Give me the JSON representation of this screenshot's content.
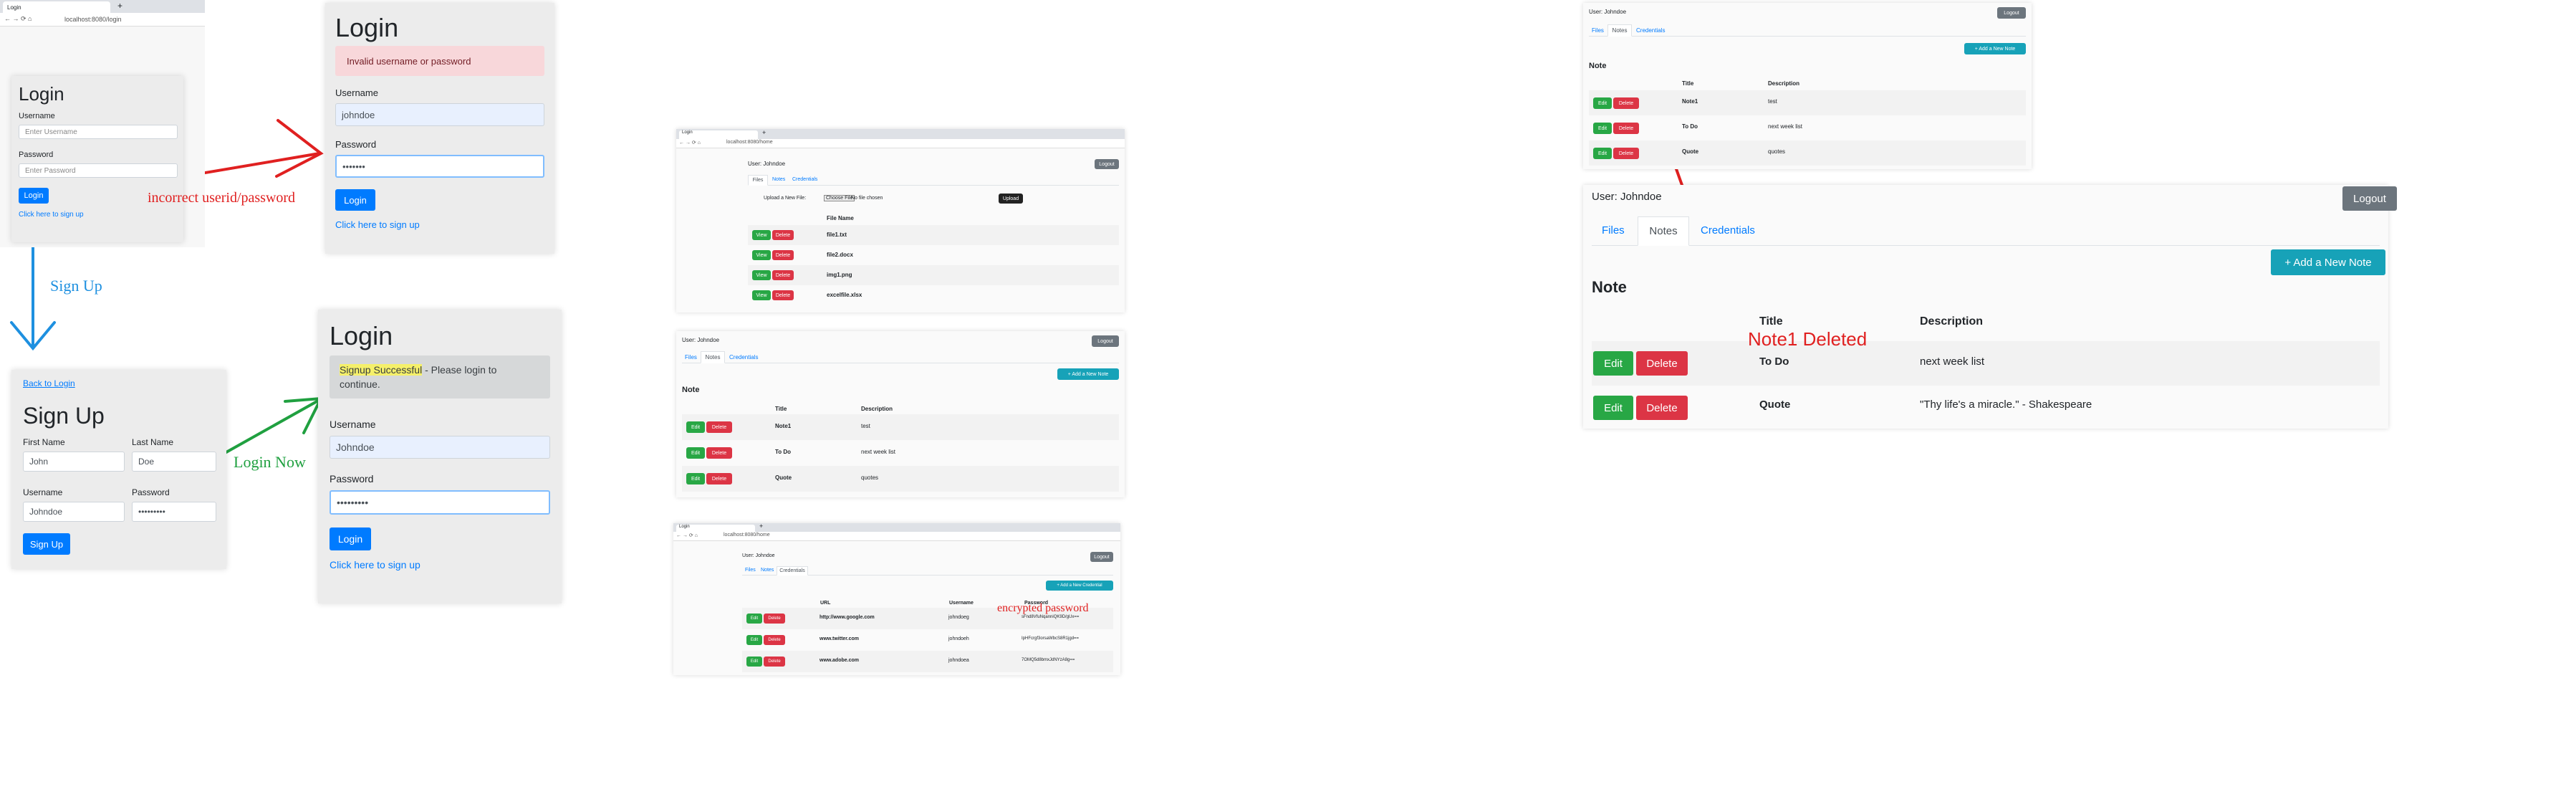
{
  "browser": {
    "tab_title": "Login",
    "new_tab": "+",
    "url": "localhost:8080/login",
    "url2": "localhost:8080/home"
  },
  "login1": {
    "title": "Login",
    "username_label": "Username",
    "username_placeholder": "Enter Username",
    "password_label": "Password",
    "password_placeholder": "Enter Password",
    "button": "Login",
    "signup_link": "Click here to sign up"
  },
  "login_error": {
    "title": "Login",
    "alert": "Invalid username or password",
    "username_label": "Username",
    "username_value": "johndoe",
    "password_label": "Password",
    "password_value": "•••••••",
    "button": "Login",
    "signup_link": "Click here to sign up"
  },
  "signup": {
    "back_link": "Back to Login",
    "title": "Sign Up",
    "first_name_label": "First Name",
    "first_name_value": "John",
    "last_name_label": "Last Name",
    "last_name_value": "Doe",
    "username_label": "Username",
    "username_value": "Johndoe",
    "password_label": "Password",
    "password_value": "•••••••••",
    "button": "Sign Up"
  },
  "login_success": {
    "title": "Login",
    "alert_highlight": "Signup Successful",
    "alert_rest": " - Please login to continue.",
    "username_label": "Username",
    "username_value": "Johndoe",
    "password_label": "Password",
    "password_value": "•••••••••",
    "button": "Login",
    "signup_link": "Click here to sign up"
  },
  "annotations": {
    "incorrect": "incorrect userid/password",
    "signup": "Sign Up",
    "login_now": "Login Now",
    "encrypted": "encrypted password",
    "deleted": "Note1 Deleted"
  },
  "home": {
    "user": "User: Johndoe",
    "logout": "Logout",
    "tabs": [
      "Files",
      "Notes",
      "Credentials"
    ],
    "upload_label": "Upload a New File:",
    "choose_file": "Choose File",
    "no_file": "No file chosen",
    "upload": "Upload",
    "view": "View",
    "edit": "Edit",
    "delete": "Delete",
    "file_name_header": "File Name",
    "files": [
      "file1.txt",
      "file2.docx",
      "img1.png",
      "excelfile.xlsx"
    ],
    "add_note": "+ Add a New Note",
    "add_credential": "+ Add a New Credential",
    "note_heading": "Note",
    "title_header": "Title",
    "description_header": "Description",
    "notes": [
      {
        "title": "Note1",
        "description": "test"
      },
      {
        "title": "To Do",
        "description": "next week list"
      },
      {
        "title": "Quote",
        "description": "quotes"
      }
    ],
    "notes_after": [
      {
        "title": "To Do",
        "description": "next week list"
      },
      {
        "title": "Quote",
        "description": "\"Thy life's a miracle.\" - Shakespeare"
      }
    ],
    "url_header": "URL",
    "username_header": "Username",
    "password_header": "Password",
    "credentials": [
      {
        "url": "http://www.google.com",
        "username": "johndoeg",
        "password": "sFnd8VfuNqanniQK9D/gUx=="
      },
      {
        "url": "www.twitter.com",
        "username": "johndoeh",
        "password": "IpHFcrgf3orsaWbcS8R1jgd=="
      },
      {
        "url": "www.adobe.com",
        "username": "johndoea",
        "password": "7OMQ5d8bmxJdNYzA8g=="
      }
    ]
  },
  "colors": {
    "annotation_red": "#e02020",
    "annotation_blue": "#1e90e0",
    "annotation_green": "#20a040",
    "primary": "#007bff",
    "danger": "#dc3545",
    "success": "#28a745"
  }
}
